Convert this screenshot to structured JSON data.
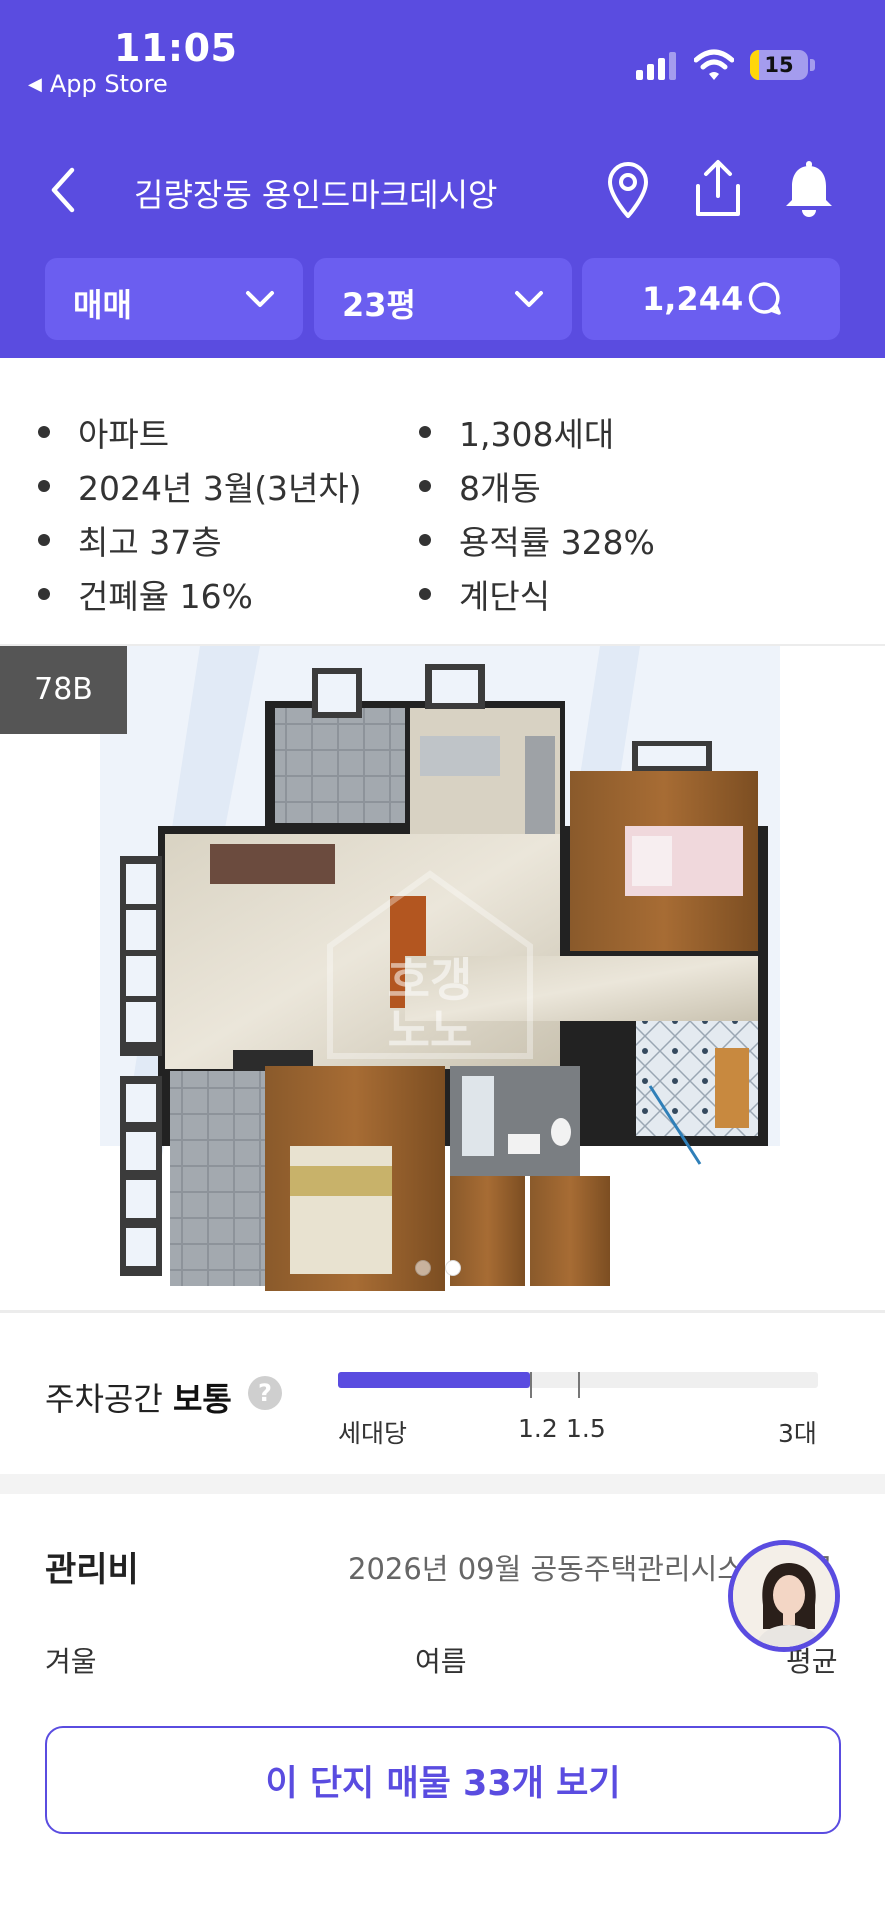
{
  "status_bar": {
    "time": "11:05",
    "back_app": "App Store",
    "battery_level": "15"
  },
  "nav": {
    "title": "김량장동 용인드마크데시앙",
    "icons": [
      "back-icon",
      "location-pin-icon",
      "share-icon",
      "bell-icon"
    ]
  },
  "filters": {
    "trade_type": "매매",
    "size": "23평",
    "chat_count": "1,244"
  },
  "info": {
    "items": [
      "아파트",
      "2024년 3월(3년차)",
      "최고 37층",
      "건폐율 16%",
      "1,308세대",
      "8개동",
      "용적률 328%",
      "계단식"
    ]
  },
  "floor_plan": {
    "type_label": "78B",
    "watermark": "호갱노노",
    "page_count": 2,
    "active_page": 2
  },
  "parking": {
    "title_prefix": "주차공간",
    "title_status": "보통",
    "help": "?",
    "label_left": "세대당",
    "value": 1.2,
    "value_label": "1.2",
    "average_label": "1.5",
    "max_label": "3대",
    "max": 3
  },
  "fees": {
    "title": "관리비",
    "source": "2026년 09월 공동주택관리시스템 제공",
    "col_winter": "겨울",
    "col_summer": "여름",
    "col_average": "평균"
  },
  "cta": {
    "label": "이 단지 매물 33개 보기"
  },
  "colors": {
    "brand": "#5a4ce0",
    "filter_bg": "#6b5ef0",
    "battery": "#ffd60a"
  }
}
